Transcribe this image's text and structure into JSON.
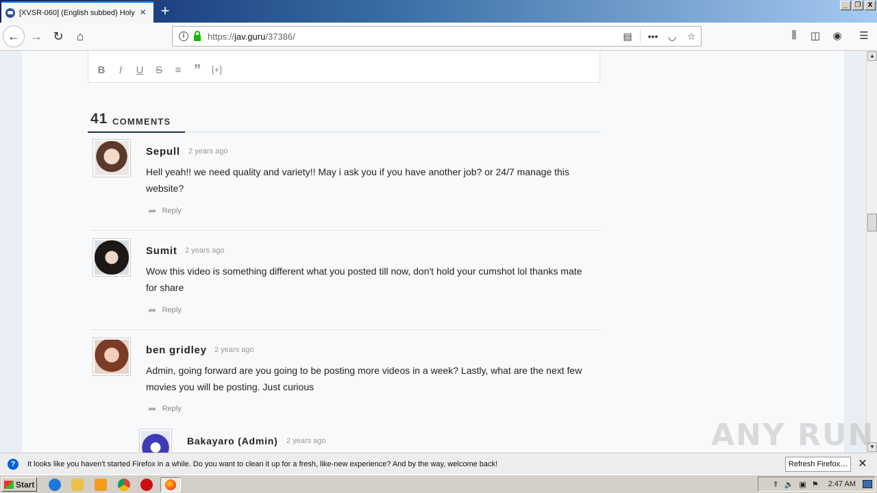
{
  "browser": {
    "tab_title": "[XVSR-060] (English subbed) Holy",
    "url_prefix": "https://",
    "url_domain": "jav.guru",
    "url_path": "/37386/",
    "window_buttons": [
      "_",
      "❐",
      "X"
    ]
  },
  "editor": {
    "toolbar": [
      "B",
      "I",
      "U",
      "S",
      "≡",
      "”",
      "[+]"
    ]
  },
  "comments": {
    "count": "41",
    "label": "COMMENTS",
    "items": [
      {
        "author": "Sepull",
        "time": "2 years ago",
        "text": "Hell yeah!! we need quality and variety!! May i ask you if you have another job? or 24/7 manage this website?",
        "reply_label": "Reply"
      },
      {
        "author": "Sumit",
        "time": "2 years ago",
        "text": "Wow this video is something different what you posted till now, don't hold your cumshot lol thanks mate for share",
        "reply_label": "Reply"
      },
      {
        "author": "ben gridley",
        "time": "2 years ago",
        "text": "Admin, going forward are you going to be posting more videos in a week? Lastly, what are the next few movies you will be posting. Just curious",
        "reply_label": "Reply"
      },
      {
        "author": "Bakayaro (Admin)",
        "time": "2 years ago"
      }
    ]
  },
  "watermark": "ANY RUN",
  "notification": {
    "message": "It looks like you haven't started Firefox in a while. Do you want to clean it up for a fresh, like-new experience? And by the way, welcome back!",
    "button_label": "Refresh Firefox…"
  },
  "taskbar": {
    "start_label": "Start",
    "clock": "2:47 AM"
  }
}
